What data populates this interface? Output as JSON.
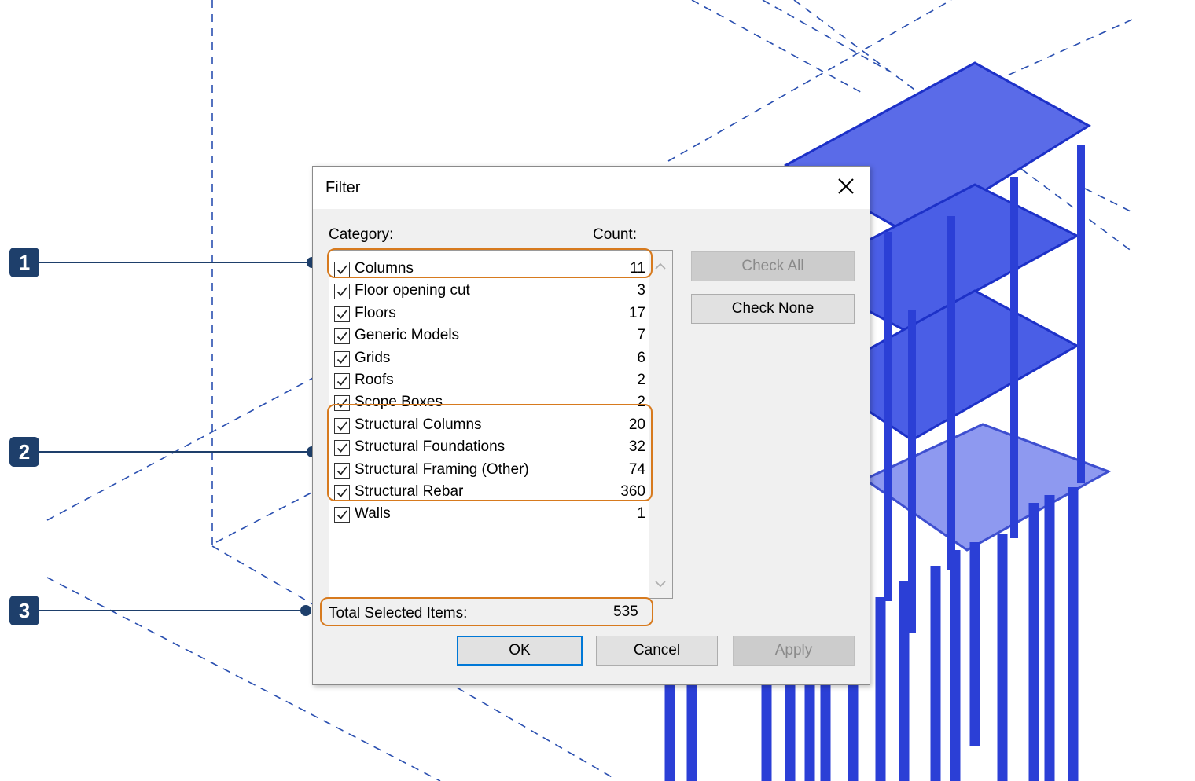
{
  "dialog": {
    "title": "Filter",
    "category_header": "Category:",
    "count_header": "Count:",
    "categories": [
      {
        "name": "Columns",
        "count": "11",
        "checked": true
      },
      {
        "name": "Floor opening cut",
        "count": "3",
        "checked": true
      },
      {
        "name": "Floors",
        "count": "17",
        "checked": true
      },
      {
        "name": "Generic Models",
        "count": "7",
        "checked": true
      },
      {
        "name": "Grids",
        "count": "6",
        "checked": true
      },
      {
        "name": "Roofs",
        "count": "2",
        "checked": true
      },
      {
        "name": "Scope Boxes",
        "count": "2",
        "checked": true
      },
      {
        "name": "Structural Columns",
        "count": "20",
        "checked": true
      },
      {
        "name": "Structural Foundations",
        "count": "32",
        "checked": true
      },
      {
        "name": "Structural Framing (Other)",
        "count": "74",
        "checked": true
      },
      {
        "name": "Structural Rebar",
        "count": "360",
        "checked": true
      },
      {
        "name": "Walls",
        "count": "1",
        "checked": true
      }
    ],
    "check_all_label": "Check All",
    "check_none_label": "Check None",
    "total_label": "Total Selected Items:",
    "total_value": "535",
    "ok_label": "OK",
    "cancel_label": "Cancel",
    "apply_label": "Apply"
  },
  "callouts": {
    "one": "1",
    "two": "2",
    "three": "3"
  },
  "colors": {
    "callout": "#1e3f6b",
    "highlight": "#d77a1e",
    "model_blue": "#2b3fd6",
    "dashed_line": "#2a4fb0"
  }
}
